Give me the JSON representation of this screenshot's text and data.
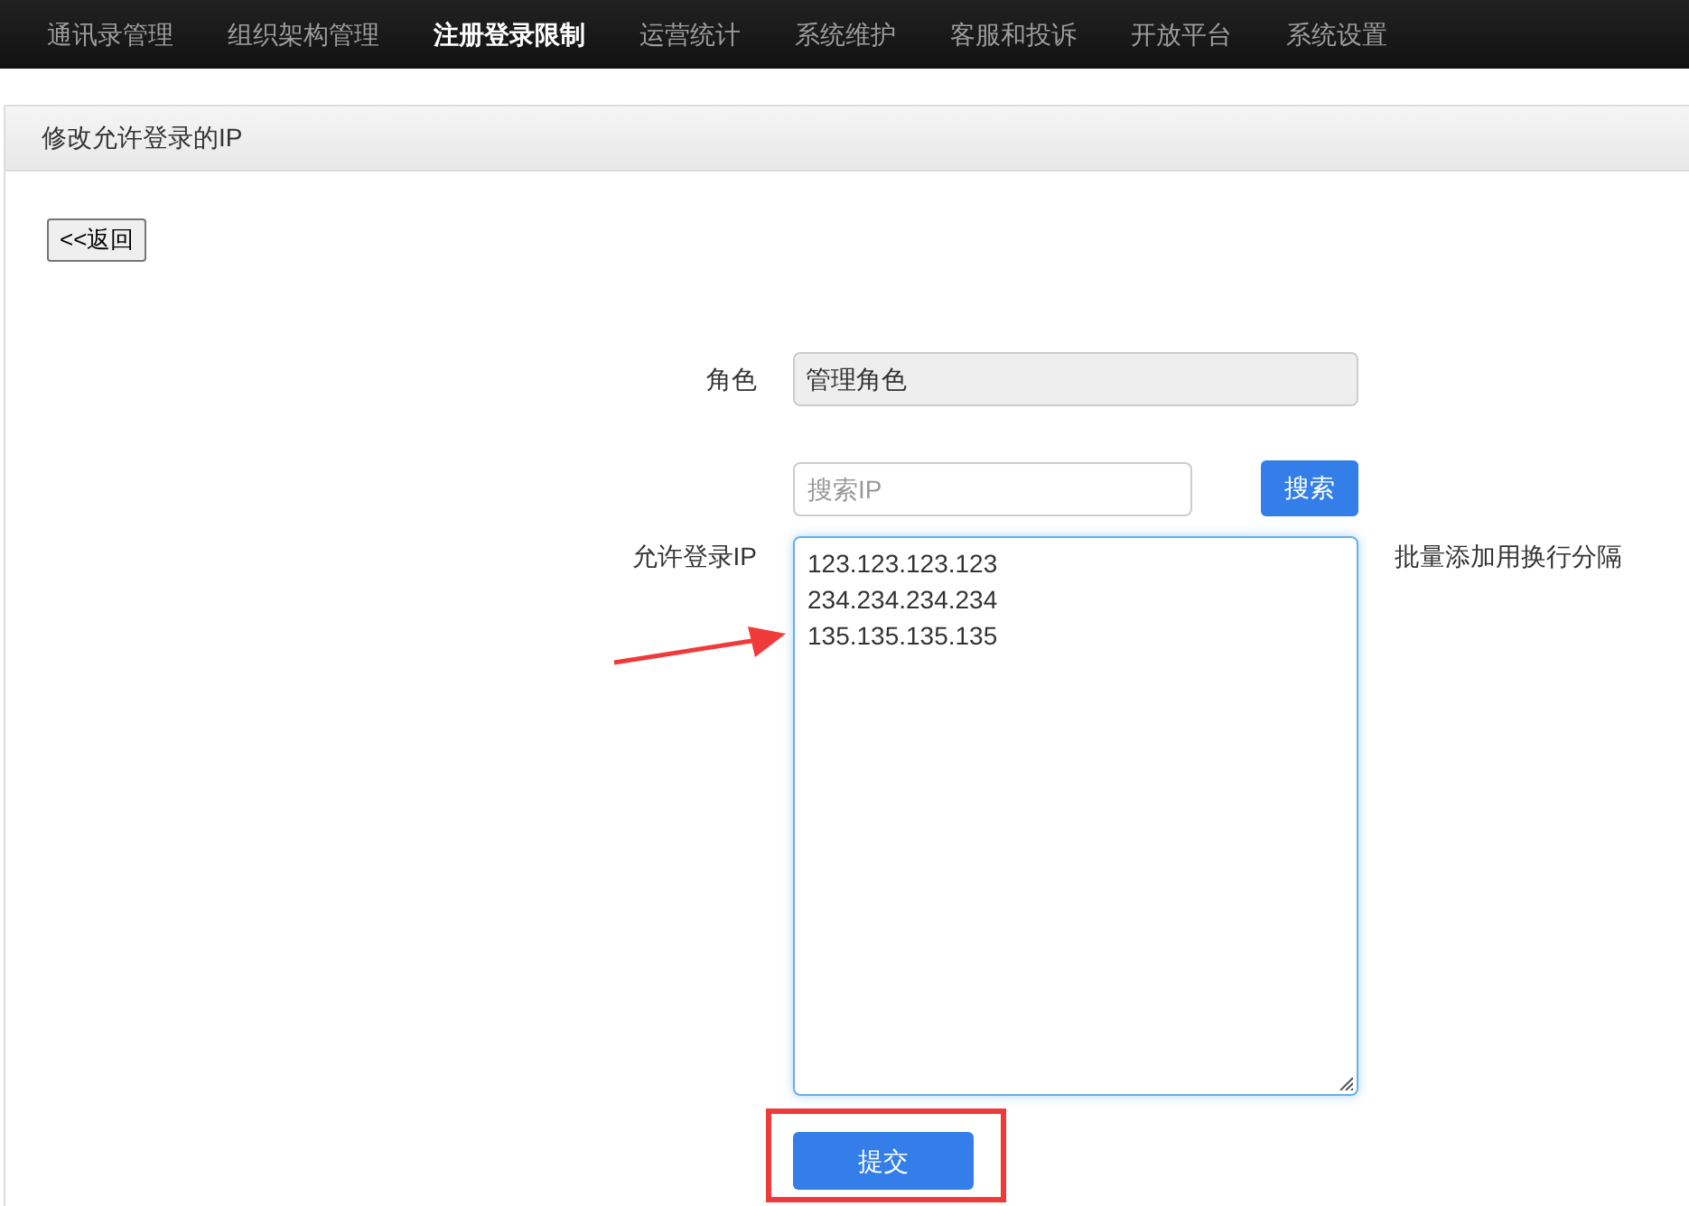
{
  "nav": [
    {
      "label": "通讯录管理",
      "selected": false
    },
    {
      "label": "组织架构管理",
      "selected": false
    },
    {
      "label": "注册登录限制",
      "selected": true
    },
    {
      "label": "运营统计",
      "selected": false
    },
    {
      "label": "系统维护",
      "selected": false
    },
    {
      "label": "客服和投诉",
      "selected": false
    },
    {
      "label": "开放平台",
      "selected": false
    },
    {
      "label": "系统设置",
      "selected": false
    }
  ],
  "panel": {
    "title": "修改允许登录的IP",
    "back_button": "<<返回",
    "form": {
      "role_label": "角色",
      "role_value": "管理角色",
      "search": {
        "placeholder": "搜索IP",
        "button": "搜索"
      },
      "ip_label": "允许登录IP",
      "ip_lines": [
        "123.123.123.123",
        "234.234.234.234",
        "135.135.135.135"
      ],
      "ip_hint": "批量添加用换行分隔",
      "submit": "提交"
    }
  }
}
